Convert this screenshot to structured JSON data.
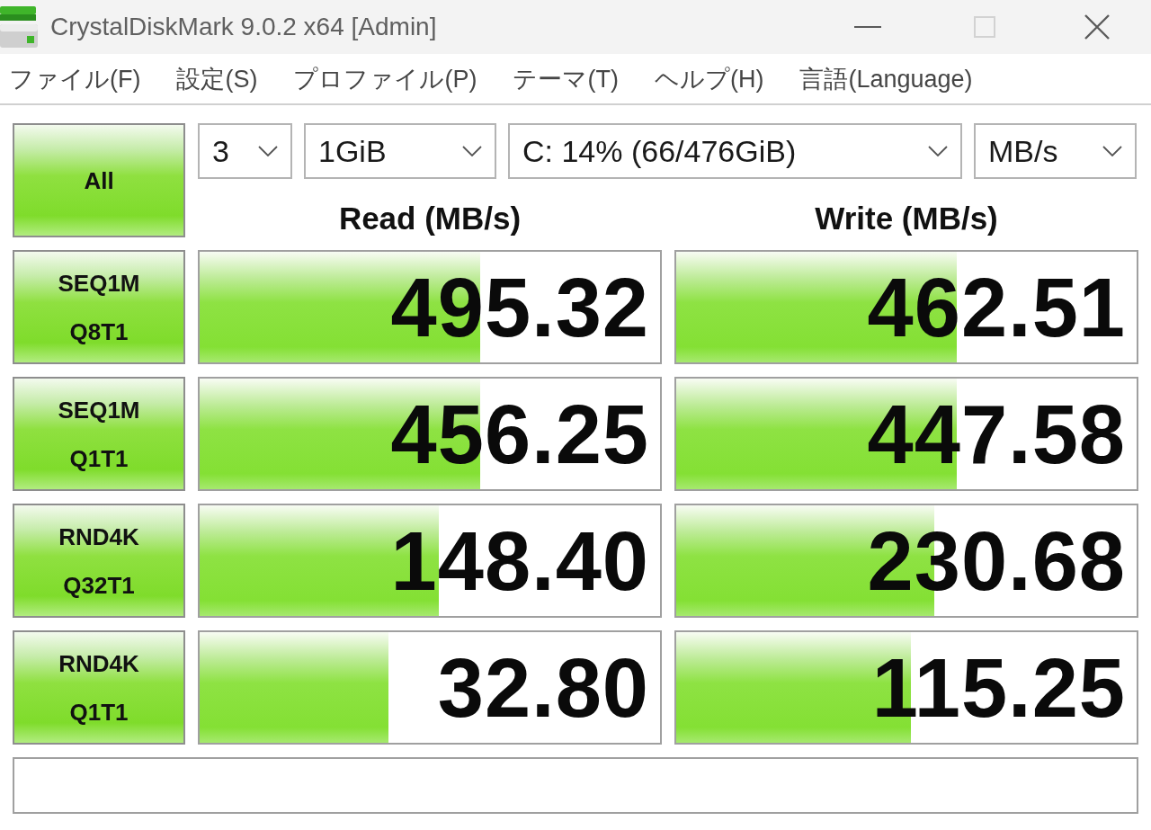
{
  "window": {
    "title": "CrystalDiskMark 9.0.2 x64 [Admin]",
    "controls": [
      {
        "kind": "minimize",
        "disabled": false
      },
      {
        "kind": "maximize",
        "disabled": true
      },
      {
        "kind": "close",
        "disabled": false
      }
    ]
  },
  "menu": [
    "ファイル(F)",
    "設定(S)",
    "プロファイル(P)",
    "テーマ(T)",
    "ヘルプ(H)",
    "言語(Language)"
  ],
  "all_button": "All",
  "settings": [
    {
      "value": "3"
    },
    {
      "value": "1GiB"
    },
    {
      "value": "C: 14% (66/476GiB)"
    },
    {
      "value": "MB/s"
    }
  ],
  "columns": [
    "Read (MB/s)",
    "Write (MB/s)"
  ],
  "tests": [
    {
      "label_lines": [
        "SEQ1M",
        "Q8T1"
      ],
      "read": {
        "value": "495.32",
        "level": 0.61
      },
      "write": {
        "value": "462.51",
        "level": 0.61
      }
    },
    {
      "label_lines": [
        "SEQ1M",
        "Q1T1"
      ],
      "read": {
        "value": "456.25",
        "level": 0.61
      },
      "write": {
        "value": "447.58",
        "level": 0.61
      }
    },
    {
      "label_lines": [
        "RND4K",
        "Q32T1"
      ],
      "read": {
        "value": "148.40",
        "level": 0.52
      },
      "write": {
        "value": "230.68",
        "level": 0.56
      }
    },
    {
      "label_lines": [
        "RND4K",
        "Q1T1"
      ],
      "read": {
        "value": "32.80",
        "level": 0.41
      },
      "write": {
        "value": "115.25",
        "level": 0.51
      }
    }
  ]
}
